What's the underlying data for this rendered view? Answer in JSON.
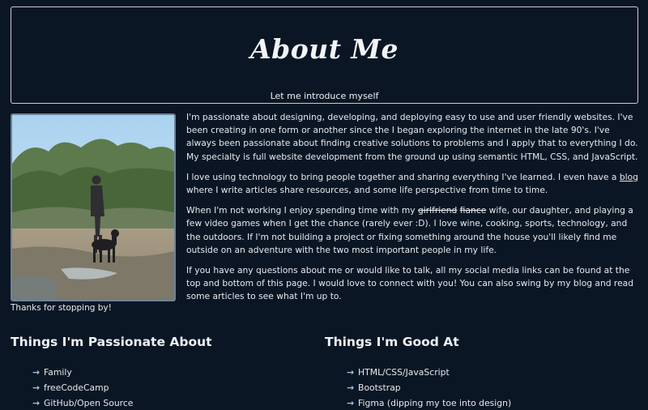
{
  "header": {
    "title": "About Me",
    "subtitle": "Let me introduce myself"
  },
  "photo": {
    "icon": "profile-photo"
  },
  "caption": "Thanks for stopping by!",
  "bio": {
    "p1": "I'm passionate about designing, developing, and deploying easy to use and user friendly websites. I've been creating in one form or another since the I began exploring the internet in the late 90's. I've always been passionate about finding creative solutions to problems and I apply that to everything I do. My specialty is full website development from the ground up using semantic HTML, CSS, and JavaScript.",
    "p2_before": "I love using technology to bring people together and sharing everything I've learned. I even have a ",
    "p2_link": "blog",
    "p2_after": " where I write articles share resources, and some life perspective from time to time.",
    "p3_before": "When I'm not working I enjoy spending time with my ",
    "p3_strike1": "girlfriend",
    "p3_strike2": "fiance",
    "p3_after": " wife, our daughter, and playing a few video games when I get the chance (rarely ever :D). I love wine, cooking, sports, technology, and the outdoors. If I'm not building a project or fixing something around the house you'll likely find me outside on an adventure with the two most important people in my life.",
    "p4": "If you have any questions about me or would like to talk, all my social media links can be found at the top and bottom of this page. I would love to connect with you! You can also swing by my blog and read some articles to see what I'm up to."
  },
  "passionate": {
    "title": "Things I'm Passionate About",
    "items": [
      "Family",
      "freeCodeCamp",
      "GitHub/Open Source"
    ]
  },
  "good_at": {
    "title": "Things I'm Good At",
    "items": [
      "HTML/CSS/JavaScript",
      "Bootstrap",
      "Figma (dipping my toe into design)"
    ]
  },
  "arrow_glyph": "→",
  "colors": {
    "background": "#0b1624",
    "accent_arrow": "#9ec5ec",
    "border": "#c7ccd3"
  }
}
